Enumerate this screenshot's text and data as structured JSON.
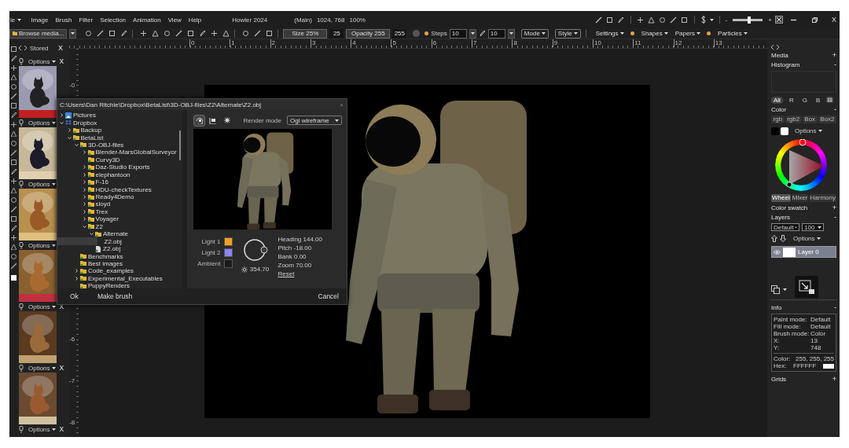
{
  "titlebar": {
    "menu_stub": "le",
    "menus": [
      "Image",
      "Brush",
      "Filter",
      "Selection",
      "Animation",
      "View",
      "Help"
    ],
    "title": "Howler 2024",
    "document": "(Main)",
    "dimensions": "1024, 768",
    "zoom": "100%",
    "zoom_out": "-",
    "zoom_in": "+",
    "zoom_slider": {
      "level": 0.55
    },
    "close": "X"
  },
  "toolbar": {
    "browse": "Browse media...",
    "size": "Size 25%",
    "size_value": "25",
    "opacity": "Opacity 255",
    "opacity_value": "255",
    "steps_label": "Steps",
    "steps": "10",
    "spacing": "10",
    "dropdowns": [
      "Mode",
      "Style"
    ],
    "panel_menus": [
      {
        "label": "Settings",
        "dot": true
      },
      {
        "label": "Shapes",
        "dot": false
      },
      {
        "label": "Papers",
        "dot": true
      },
      {
        "label": "Particles",
        "dot": false
      }
    ]
  },
  "ruler": {
    "horizontal": [
      "0",
      "1",
      "2",
      "3",
      "4",
      "5",
      "6",
      "7",
      "8",
      "9",
      "10",
      "11",
      "12",
      "13"
    ],
    "vertical": [
      "-0",
      "-6",
      "-7",
      "-8"
    ]
  },
  "stored": {
    "title": "Stored",
    "close": "X",
    "items": [
      {
        "options": "Options",
        "close": "X",
        "kind": "picture"
      },
      {
        "options": "Options",
        "kind": "picture"
      },
      {
        "options": "Options",
        "kind": "picture"
      },
      {
        "options": "Options",
        "kind": "picture"
      },
      {
        "options": "Options",
        "close": "X",
        "kind": "picture"
      },
      {
        "options": "Options",
        "close": "X",
        "kind": "picture"
      },
      {
        "options": "Options",
        "close": "X"
      }
    ]
  },
  "canvas": {
    "kind": "picture"
  },
  "dialog": {
    "path": "C:\\Users\\Dan Ritchie\\Dropbox\\BetaList\\3D-OBJ-files\\Z2\\Alternate\\Z2.obj",
    "close": "×",
    "tree": [
      {
        "label": "Pictures",
        "kind": "pictures",
        "expanded": false,
        "selected": false
      },
      {
        "label": "Dropbox",
        "kind": "dropbox",
        "expanded": true,
        "selected": false,
        "children": [
          {
            "label": "Backup",
            "kind": "folder",
            "expanded": false,
            "selected": false
          },
          {
            "label": "BetaList",
            "kind": "folder",
            "expanded": true,
            "selected": false,
            "children": [
              {
                "label": "3D-OBJ-files",
                "kind": "folder",
                "expanded": true,
                "selected": false,
                "children": [
                  {
                    "label": "Blender-MarsGlobalSurveyor",
                    "kind": "folder",
                    "expanded": false,
                    "selected": false
                  },
                  {
                    "label": "Curvy3D",
                    "kind": "folder",
                    "selected": false
                  },
                  {
                    "label": "Daz-Studio Exports",
                    "kind": "folder",
                    "expanded": false,
                    "selected": false
                  },
                  {
                    "label": "elephantoon",
                    "kind": "folder",
                    "expanded": false,
                    "selected": false
                  },
                  {
                    "label": "F-16",
                    "kind": "folder",
                    "expanded": false,
                    "selected": false
                  },
                  {
                    "label": "HDU-checkTextures",
                    "kind": "folder",
                    "expanded": false,
                    "selected": false
                  },
                  {
                    "label": "Ready4Demo",
                    "kind": "folder",
                    "expanded": false,
                    "selected": false
                  },
                  {
                    "label": "sloyd",
                    "kind": "folder",
                    "expanded": false,
                    "selected": false
                  },
                  {
                    "label": "Trex",
                    "kind": "folder",
                    "expanded": false,
                    "selected": false
                  },
                  {
                    "label": "Voyager",
                    "kind": "folder",
                    "expanded": false,
                    "selected": false
                  },
                  {
                    "label": "Z2",
                    "kind": "folder",
                    "expanded": true,
                    "selected": false,
                    "children": [
                      {
                        "label": "Alternate",
                        "kind": "folder",
                        "expanded": true,
                        "selected": false,
                        "children": [
                          {
                            "label": "Z2.obj",
                            "kind": "file",
                            "selected": true
                          }
                        ]
                      },
                      {
                        "label": "Z2.obj",
                        "kind": "file",
                        "selected": false
                      }
                    ]
                  }
                ]
              },
              {
                "label": "Benchmarks",
                "kind": "folder",
                "selected": false
              },
              {
                "label": "Best images",
                "kind": "folder",
                "selected": false
              },
              {
                "label": "Code_examples",
                "kind": "folder",
                "expanded": false,
                "selected": false
              },
              {
                "label": "Experimental_Executables",
                "kind": "folder",
                "expanded": false,
                "selected": false
              },
              {
                "label": "PuppyRenders",
                "kind": "folder",
                "selected": false
              }
            ]
          }
        ]
      }
    ],
    "view_modes": [
      {
        "selected": true
      },
      {
        "selected": false
      },
      {
        "selected": false
      }
    ],
    "render_mode_label": "Render mode",
    "render_mode": "Ogl wireframe",
    "preview": {
      "kind": "picture"
    },
    "lights": [
      {
        "label": "Light 1",
        "color": "#f5a020"
      },
      {
        "label": "Light 2",
        "color": "#8c84f5"
      },
      {
        "label": "Ambient",
        "color": "#1a1a1a"
      }
    ],
    "light_angle": "354.70",
    "orientation": [
      "Heading 144.00",
      "Pitch -18.00",
      "Bank 0.00",
      "Zoom 70.00"
    ],
    "reset": "Reset",
    "buttons": {
      "ok": "Ok",
      "make_brush": "Make brush",
      "cancel": "Cancel"
    }
  },
  "panel": {
    "media": {
      "title": "Media",
      "toggle": "+"
    },
    "histogram": {
      "title": "Histogram",
      "toggle": "-",
      "channels": [
        {
          "label": "All",
          "selected": true
        },
        {
          "label": "R",
          "selected": false
        },
        {
          "label": "G",
          "selected": false
        },
        {
          "label": "B",
          "selected": false
        }
      ]
    },
    "color": {
      "title": "Color",
      "toggle": "-",
      "tabs": [
        {
          "label": "rgb",
          "selected": false
        },
        {
          "label": "rgb2",
          "selected": false
        },
        {
          "label": "Box",
          "selected": false
        },
        {
          "label": "Box2",
          "selected": false
        }
      ],
      "swatches": [
        {
          "color": "#000000"
        },
        {
          "color": "#ffffff"
        }
      ],
      "options": "Options",
      "modes": [
        {
          "label": "Wheel",
          "selected": true
        },
        {
          "label": "Mixer",
          "selected": false
        },
        {
          "label": "Harmony",
          "selected": false
        }
      ]
    },
    "color_swatch": {
      "title": "Color swatch",
      "toggle": "+"
    },
    "layers": {
      "title": "Layers",
      "toggle": "-",
      "blend": "Default",
      "opacity": "100",
      "options": "Options",
      "items": [
        {
          "name": "Layer 0",
          "visible": true,
          "selected": true
        }
      ]
    },
    "info": {
      "title": "Info",
      "toggle": "-",
      "rows": [
        {
          "label": "Paint mode:",
          "value": "Default"
        },
        {
          "label": "Fill mode:",
          "value": "Default"
        },
        {
          "label": "Brush mode:",
          "value": "Color"
        },
        {
          "label": "X:",
          "value": "13"
        },
        {
          "label": "Y:",
          "value": "748"
        }
      ],
      "color_label": "Color:",
      "color_value": "255, 255, 255",
      "hex_label": "Hex:",
      "hex_value": "FFFFFF"
    },
    "grids": {
      "title": "Grids",
      "toggle": "+"
    }
  }
}
